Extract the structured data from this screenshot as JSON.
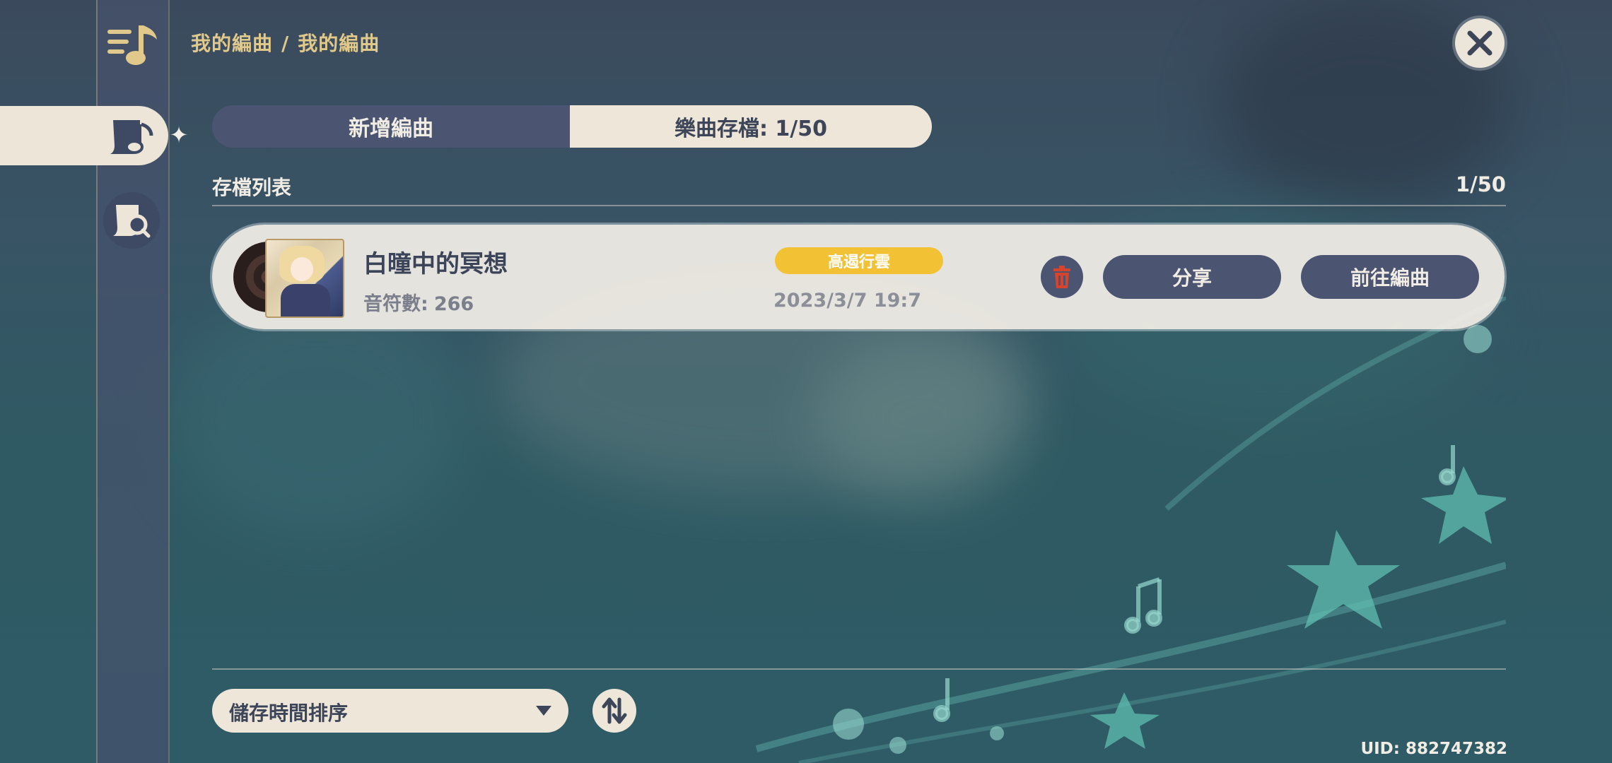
{
  "breadcrumb": {
    "part1": "我的編曲",
    "separator": "/",
    "part2": "我的編曲"
  },
  "tabs": {
    "new": "新增編曲",
    "saved": "樂曲存檔: 1/50"
  },
  "list": {
    "title": "存檔列表",
    "count": "1/50",
    "items": [
      {
        "name": "白曈中的冥想",
        "notes_label": "音符數:",
        "notes_value": "266",
        "tag": "高遏行雲",
        "date": "2023/3/7 19:7",
        "share_label": "分享",
        "goto_label": "前往編曲"
      }
    ]
  },
  "sort": {
    "selected": "儲存時間排序"
  },
  "uid": "UID: 882747382",
  "colors": {
    "accent_gold": "#e0c98a",
    "tag_yellow": "#f2c234",
    "button_dark": "#4b5572",
    "trash_red": "#d8432c",
    "panel_light": "#ede6d9"
  },
  "icons": [
    "music-list-icon",
    "score-active-icon",
    "sparkle-icon",
    "score-search-icon",
    "close-icon",
    "trash-icon",
    "chevron-down-icon",
    "sort-order-icon"
  ]
}
